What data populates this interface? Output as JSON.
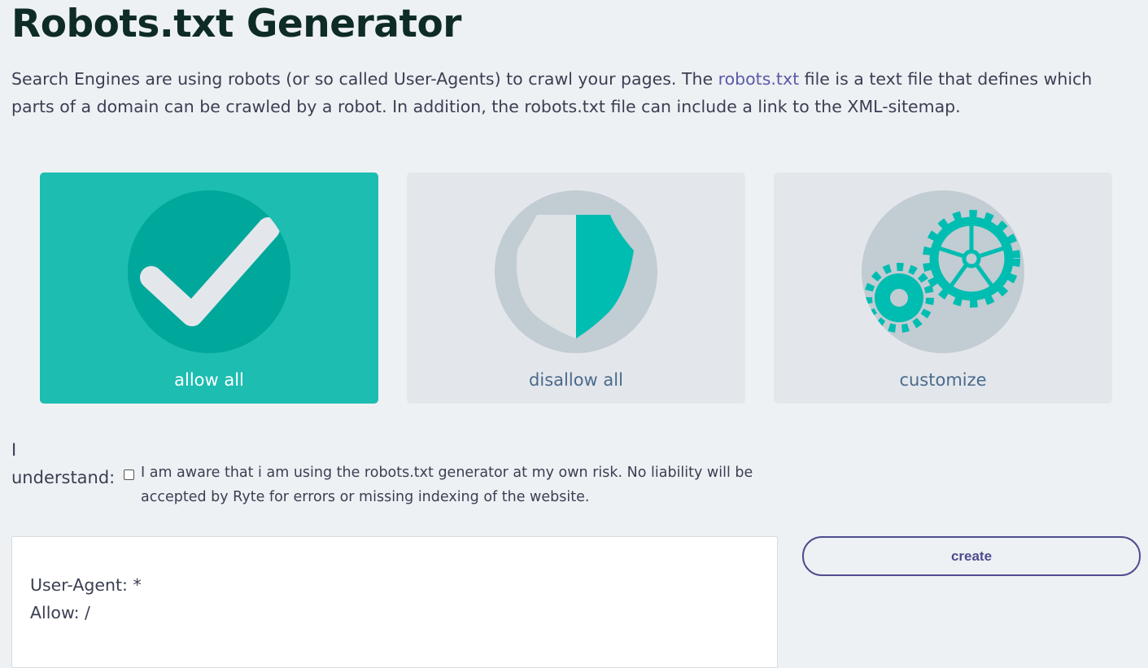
{
  "page": {
    "title": "Robots.txt Generator",
    "intro_before_link": "Search Engines are using robots (or so called User-Agents) to crawl your pages. The ",
    "intro_link": "robots.txt",
    "intro_after_link": " file is a text file that defines which parts of a domain can be crawled by a robot. In addition, the robots.txt file can include a link to the XML-sitemap."
  },
  "options": [
    {
      "label": "allow all",
      "icon": "checkmark-icon",
      "selected": true
    },
    {
      "label": "disallow all",
      "icon": "shield-icon",
      "selected": false
    },
    {
      "label": "customize",
      "icon": "gears-icon",
      "selected": false
    }
  ],
  "consent": {
    "label_line1": "I",
    "label_line2": "understand:",
    "checked": false,
    "text": "I am aware that i am using the robots.txt generator at my own risk. No liability will be accepted by Ryte for errors or missing indexing of the website."
  },
  "output": {
    "lines": [
      "User-Agent: *",
      "Allow: /"
    ]
  },
  "actions": {
    "create_label": "create"
  },
  "colors": {
    "accent": "#1dbdb1",
    "accent_dark": "#00a79b",
    "card_bg": "#e3e7eb",
    "icon_circle": "#c1ccd3",
    "button_border": "#4e4c8f",
    "link": "#5a5aa6"
  }
}
